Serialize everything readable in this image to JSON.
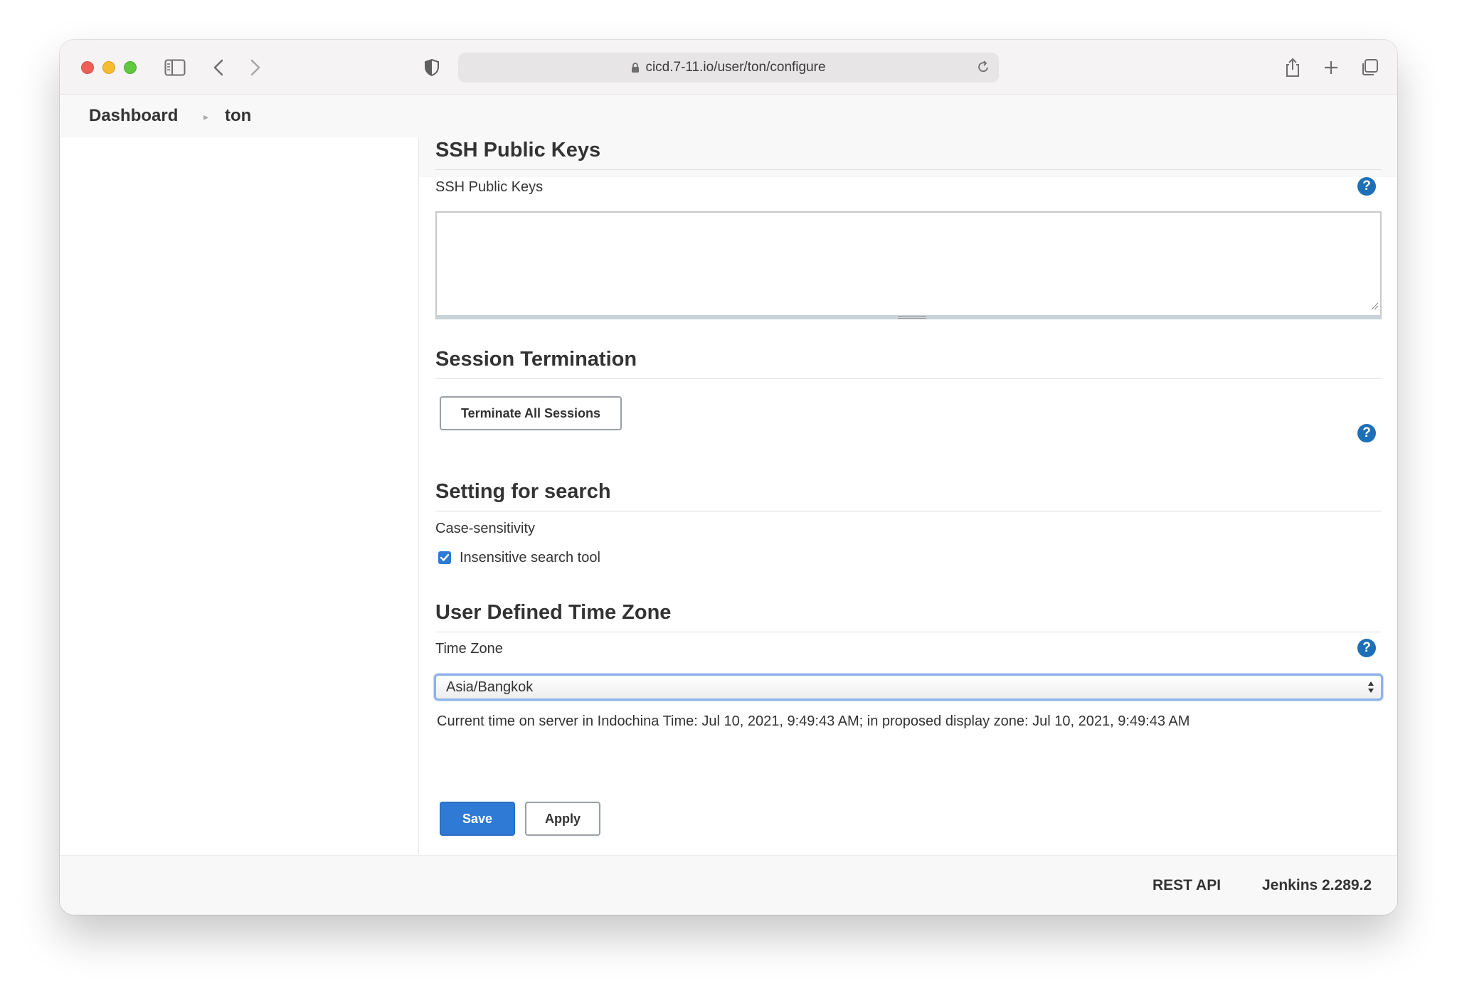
{
  "browser": {
    "url": "cicd.7-11.io/user/ton/configure"
  },
  "breadcrumb": {
    "items": [
      {
        "label": "Dashboard"
      },
      {
        "label": "ton"
      }
    ]
  },
  "ssh": {
    "section_title": "SSH Public Keys",
    "field_label": "SSH Public Keys",
    "value": ""
  },
  "session": {
    "section_title": "Session Termination",
    "terminate_label": "Terminate All Sessions"
  },
  "search": {
    "section_title": "Setting for search",
    "field_label": "Case-sensitivity",
    "checkbox_label": "Insensitive search tool",
    "checked": true
  },
  "timezone": {
    "section_title": "User Defined Time Zone",
    "field_label": "Time Zone",
    "selected": "Asia/Bangkok",
    "helptext": "Current time on server in Indochina Time: Jul 10, 2021, 9:49:43 AM; in proposed display zone: Jul 10, 2021, 9:49:43 AM"
  },
  "actions": {
    "save_label": "Save",
    "apply_label": "Apply"
  },
  "footer": {
    "rest_api": "REST API",
    "version": "Jenkins 2.289.2"
  },
  "colors": {
    "primary": "#2f7ad4",
    "help": "#1d6fb8"
  }
}
